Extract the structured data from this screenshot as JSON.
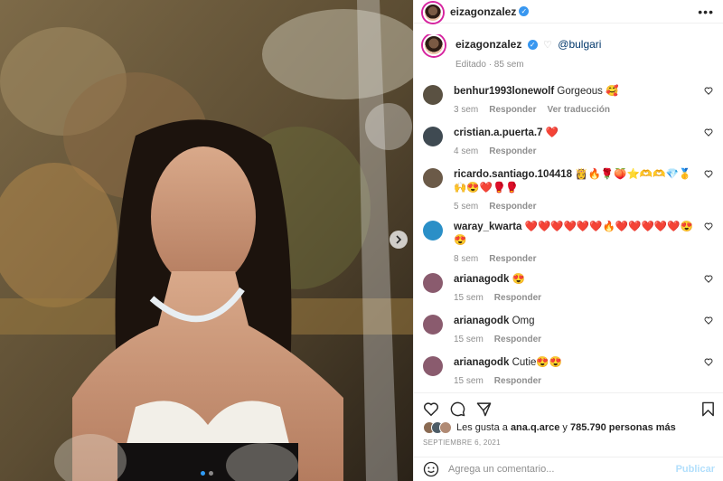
{
  "post": {
    "username": "eizagonzalez",
    "verified_mark": "✓",
    "more_label": "•••",
    "caption_username": "eizagonzalez",
    "caption_heart": "♡",
    "caption_mention": "@bulgari",
    "caption_meta": "Editado · 85 sem"
  },
  "comments": [
    {
      "user": "benhur1993lonewolf",
      "text": "Gorgeous 🥰",
      "time": "3 sem",
      "reply": "Responder",
      "translate": "Ver traducción",
      "avatar_color": "#5a5142"
    },
    {
      "user": "cristian.a.puerta.7",
      "text": "❤️",
      "time": "4 sem",
      "reply": "Responder",
      "translate": "",
      "avatar_color": "#3f4a52"
    },
    {
      "user": "ricardo.santiago.104418",
      "text": "👸🔥🌹🍑⭐️🫶🫶💎🥇🙌😍❤️🥊🥊",
      "time": "5 sem",
      "reply": "Responder",
      "translate": "",
      "avatar_color": "#6b5a48"
    },
    {
      "user": "waray_kwarta",
      "text": "❤️❤️❤️❤️❤️❤️🔥❤️❤️❤️❤️❤️😍😍",
      "time": "8 sem",
      "reply": "Responder",
      "translate": "",
      "avatar_color": "#2a8fc7"
    },
    {
      "user": "arianagodk",
      "text": "😍",
      "time": "15 sem",
      "reply": "Responder",
      "translate": "",
      "avatar_color": "#8a5b6e"
    },
    {
      "user": "arianagodk",
      "text": "Omg",
      "time": "15 sem",
      "reply": "Responder",
      "translate": "",
      "avatar_color": "#8a5b6e"
    },
    {
      "user": "arianagodk",
      "text": "Cutie😍😍",
      "time": "15 sem",
      "reply": "Responder",
      "translate": "",
      "avatar_color": "#8a5b6e"
    }
  ],
  "likes": {
    "prefix": "Les gusta a ",
    "first_user": "ana.q.arce",
    "middle": " y ",
    "count": "785.790 personas más"
  },
  "date": "SEPTIEMBRE 6, 2021",
  "composer": {
    "emoji_icon": "smiley-icon",
    "placeholder": "Agrega un comentario...",
    "publish_label": "Publicar"
  },
  "colors": {
    "verified": "#3897f0",
    "link": "#00376b",
    "publish_disabled": "#b2dffc",
    "carousel_active_dot": "#2f9bf6"
  },
  "carousel": {
    "slides": 2,
    "active": 1
  }
}
